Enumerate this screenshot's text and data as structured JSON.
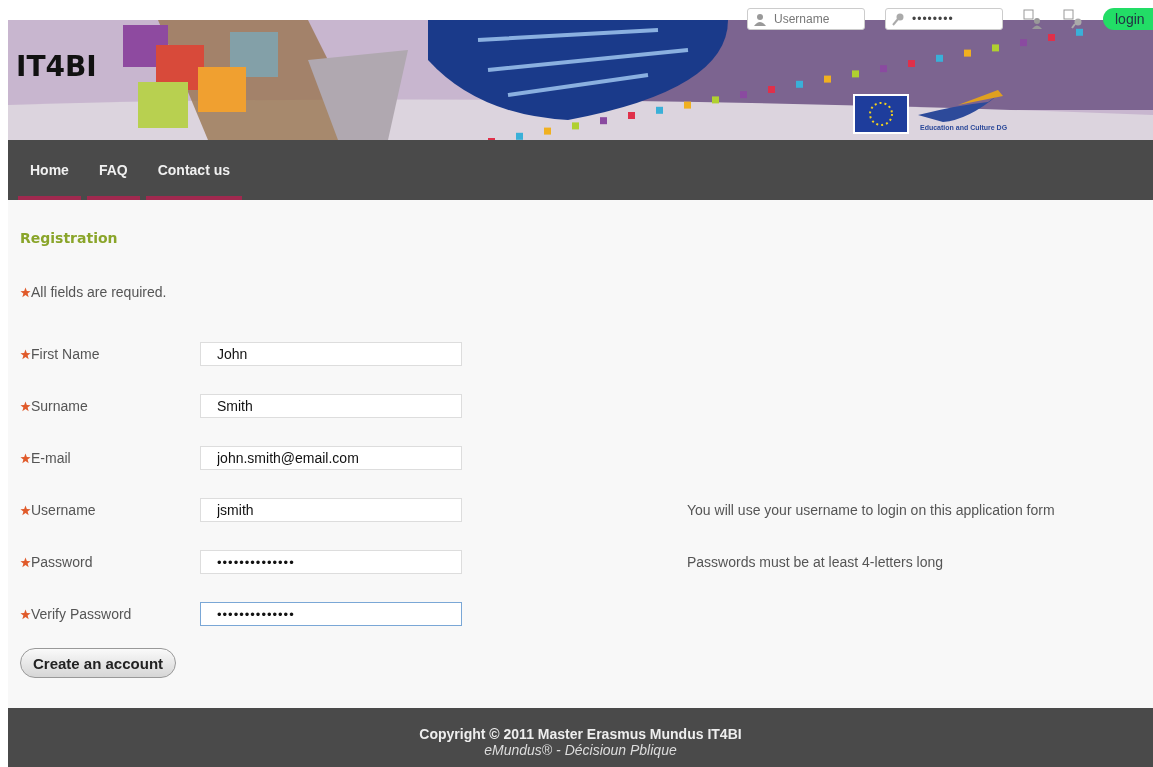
{
  "login_bar": {
    "username_placeholder": "Username",
    "password_value": "••••••••",
    "login_button": "login"
  },
  "header": {
    "logo": "IT4BI",
    "partner_caption": "Education and Culture DG"
  },
  "nav": [
    {
      "label": "Home"
    },
    {
      "label": "FAQ"
    },
    {
      "label": "Contact us"
    }
  ],
  "page_title": "Registration",
  "required_note": "All fields are required.",
  "fields": [
    {
      "kind": "text",
      "label": "First Name",
      "value": "John",
      "focused": false
    },
    {
      "kind": "text",
      "label": "Surname",
      "value": "Smith",
      "focused": false
    },
    {
      "kind": "text",
      "label": "E-mail",
      "value": "john.smith@email.com",
      "focused": false
    },
    {
      "kind": "text",
      "label": "Username",
      "value": "jsmith",
      "focused": false,
      "hint": "You will use your username to login on this application form"
    },
    {
      "kind": "password",
      "label": "Password",
      "value": "••••••••••••••",
      "focused": false,
      "hint": "Passwords must be at least 4-letters long"
    },
    {
      "kind": "password",
      "label": "Verify Password",
      "value": "••••••••••••••",
      "focused": true
    }
  ],
  "submit_button": "Create an account",
  "footer": {
    "copyright": "Copyright © 2011 Master Erasmus Mundus IT4BI",
    "credit": "eMundus® - Décisioun Pblique"
  }
}
